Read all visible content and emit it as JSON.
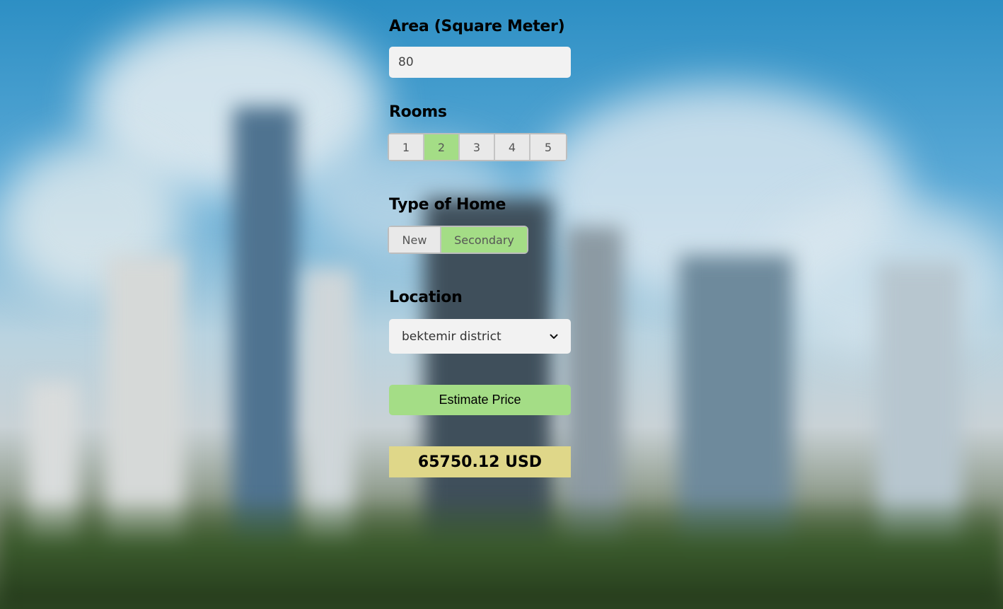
{
  "area": {
    "label": "Area (Square Meter)",
    "value": "80"
  },
  "rooms": {
    "label": "Rooms",
    "options": [
      "1",
      "2",
      "3",
      "4",
      "5"
    ],
    "selected": "2"
  },
  "home_type": {
    "label": "Type of Home",
    "options": [
      "New",
      "Secondary"
    ],
    "selected": "Secondary"
  },
  "location": {
    "label": "Location",
    "selected": "bektemir district"
  },
  "estimate_button": {
    "label": "Estimate Price"
  },
  "result": {
    "text": "65750.12 USD"
  },
  "colors": {
    "accent_green": "#a4dd86",
    "result_background": "#dfd789",
    "input_background": "#f2f2f2"
  },
  "icons": {
    "location_dropdown": "chevron-down-icon"
  }
}
